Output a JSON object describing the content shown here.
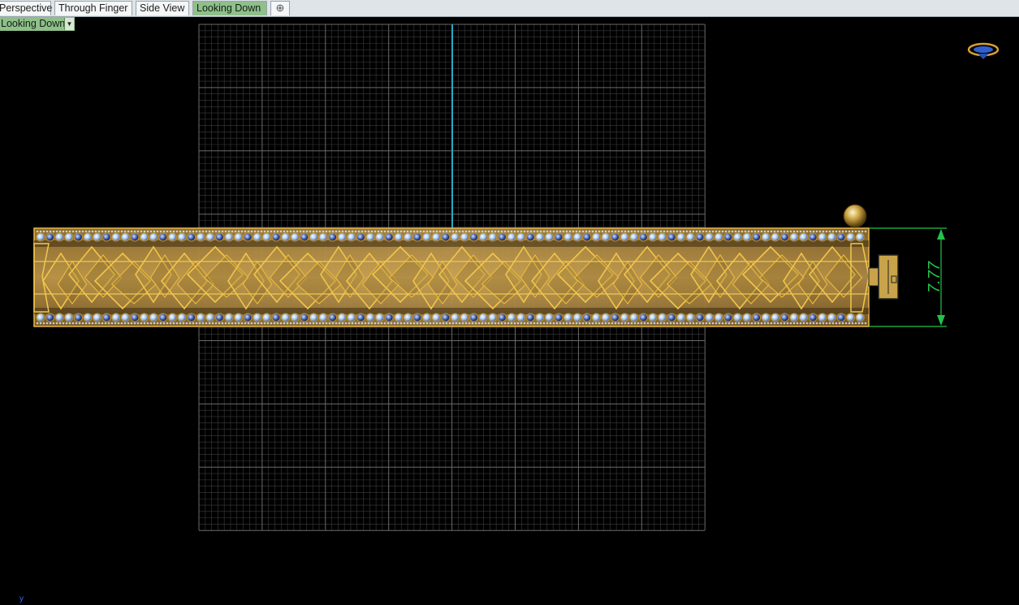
{
  "tabs": [
    {
      "label": "Perspective",
      "active": false
    },
    {
      "label": "Through Finger",
      "active": false
    },
    {
      "label": "Side View",
      "active": false
    },
    {
      "label": "Looking Down",
      "active": true
    }
  ],
  "add_tab_icon": "plus-icon",
  "viewport": {
    "dropdown_label": "Looking Down",
    "dropdown_icon": "chevron-down-icon",
    "dimension": "7.77",
    "axis_label": "y",
    "nav_widget_icon": "view-navigation-widget-icon"
  },
  "colors": {
    "background": "#000000",
    "grid": "#3c3c3c",
    "grid_major": "#6a6a6a",
    "axis": "#2aa8c8",
    "gold": "#d4a73a",
    "dimension": "#22c34a",
    "active_tab": "#8fbf8b"
  }
}
